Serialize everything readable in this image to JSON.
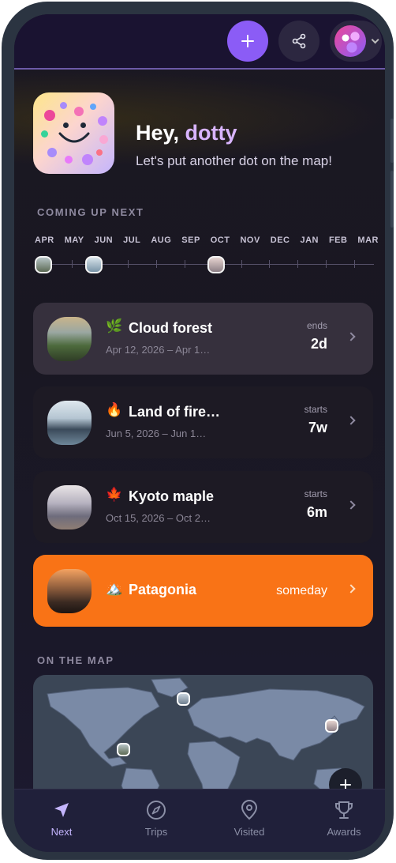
{
  "header": {
    "add_icon": "plus-icon",
    "share_icon": "share-icon",
    "profile_icon": "avatar"
  },
  "greeting": {
    "hey": "Hey, ",
    "name": "dotty",
    "tagline": "Let's put another dot on the map!"
  },
  "coming_up": {
    "label": "COMING UP NEXT",
    "months": [
      "APR",
      "MAY",
      "JUN",
      "JUL",
      "AUG",
      "SEP",
      "OCT",
      "NOV",
      "DEC",
      "JAN",
      "FEB",
      "MAR"
    ]
  },
  "trips": [
    {
      "emoji": "🌿",
      "name": "Cloud forest",
      "dates": "Apr 12, 2026 – Apr 1…",
      "when": "ends",
      "count": "2d",
      "style": "active"
    },
    {
      "emoji": "🔥",
      "name": "Land of fire…",
      "dates": "Jun 5, 2026 – Jun 1…",
      "when": "starts",
      "count": "7w",
      "style": "default"
    },
    {
      "emoji": "🍁",
      "name": "Kyoto maple",
      "dates": "Oct 15, 2026 – Oct 2…",
      "when": "starts",
      "count": "6m",
      "style": "default"
    },
    {
      "emoji": "🏔️",
      "name": "Patagonia",
      "dates": "",
      "when": "someday",
      "count": "",
      "style": "orange"
    }
  ],
  "map": {
    "label": "ON THE MAP",
    "add_icon": "plus-icon"
  },
  "nav": {
    "items": [
      {
        "label": "Next",
        "icon": "navigation-arrow-icon",
        "active": true
      },
      {
        "label": "Trips",
        "icon": "compass-icon",
        "active": false
      },
      {
        "label": "Visited",
        "icon": "map-pin-icon",
        "active": false
      },
      {
        "label": "Awards",
        "icon": "trophy-icon",
        "active": false
      }
    ]
  },
  "colors": {
    "accent": "#8b5cf6",
    "name_highlight": "#d8b4fe",
    "someday_card": "#f97316"
  }
}
